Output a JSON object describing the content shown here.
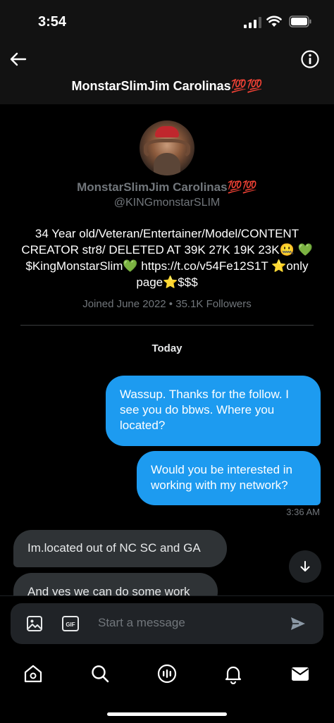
{
  "status_bar": {
    "time": "3:54"
  },
  "header": {
    "title": "MonstarSlimJim Carolinas💯💯",
    "back_icon": "arrow-left-icon",
    "info_icon": "info-icon"
  },
  "profile": {
    "display_name": "MonstarSlimJim Carolinas💯💯",
    "handle": "@KINGmonstarSLIM",
    "bio": "34 Year old/Veteran/Entertainer/Model/CONTENT CREATOR str8/ DELETED AT 39K 27K 19K 23K🤐 💚 $KingMonstarSlim💚 https://t.co/v54Fe12S1T ⭐only page⭐$$$",
    "meta": "Joined June 2022 • 35.1K Followers"
  },
  "conversation": {
    "date_label": "Today",
    "messages": [
      {
        "direction": "outgoing",
        "text": "Wassup. Thanks for the follow. I see you do bbws. Where you located?"
      },
      {
        "direction": "outgoing",
        "text": "Would you be interested in working with my network?"
      },
      {
        "direction": "incoming",
        "text": "Im.located out of NC SC and GA"
      },
      {
        "direction": "incoming",
        "text": "And yes we can do some work"
      }
    ],
    "last_outgoing_time": "3:36 AM"
  },
  "composer": {
    "placeholder": "Start a message",
    "gif_label": "GIF"
  },
  "tab_bar": {
    "items": [
      "home-icon",
      "search-icon",
      "spaces-icon",
      "notifications-icon",
      "messages-icon"
    ]
  },
  "colors": {
    "accent": "#1d9bf0",
    "incoming_bubble": "#2f3336",
    "background": "#000000",
    "muted_text": "#71767b"
  }
}
